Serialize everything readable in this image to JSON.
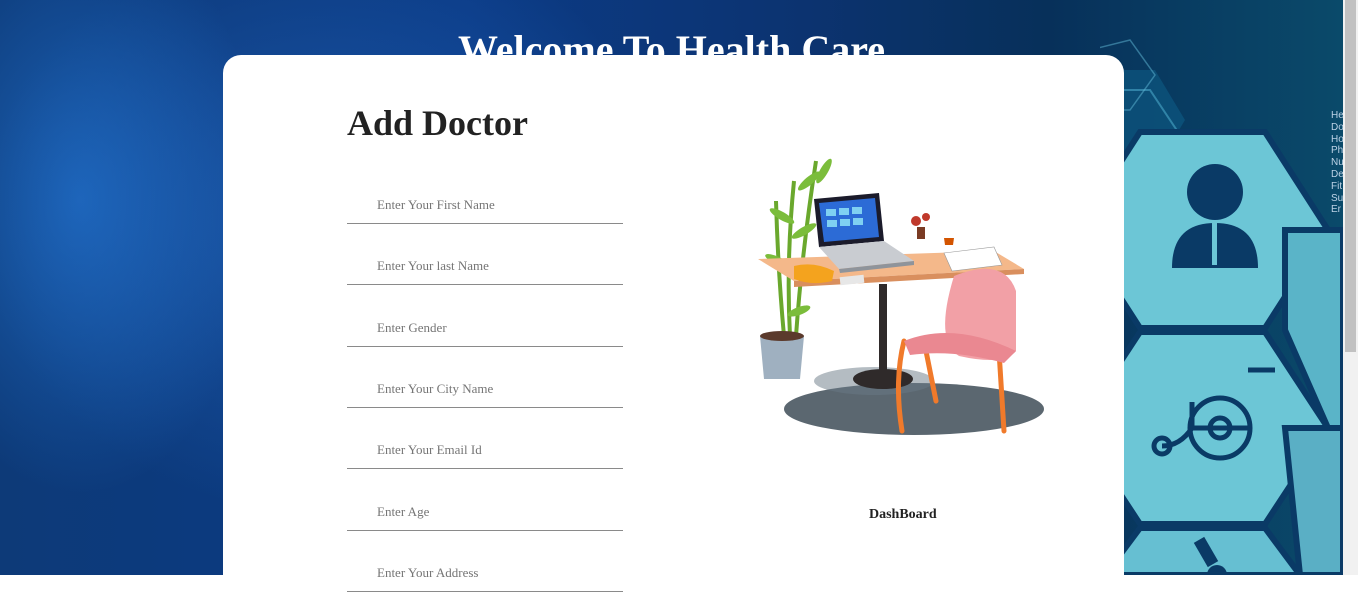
{
  "page": {
    "title": "Welcome To Health Care"
  },
  "form": {
    "heading": "Add Doctor",
    "fields": [
      {
        "placeholder": "Enter Your First Name"
      },
      {
        "placeholder": "Enter Your last Name"
      },
      {
        "placeholder": "Enter Gender"
      },
      {
        "placeholder": "Enter Your City Name"
      },
      {
        "placeholder": "Enter Your Email Id"
      },
      {
        "placeholder": "Enter Age"
      },
      {
        "placeholder": "Enter Your Address"
      }
    ]
  },
  "illustration": {
    "caption": "DashBoard",
    "icon": "desk-laptop-illustration"
  },
  "background": {
    "side_text": [
      "He",
      "Do",
      "Ho",
      "Ph",
      "Nu",
      "De",
      "Fit",
      "Su",
      "Er"
    ],
    "icons": [
      "doctor-icon",
      "wheelchair-icon",
      "microscope-icon"
    ]
  },
  "colors": {
    "background_blue": "#0b3b86",
    "hex_teal": "#6cc6d6",
    "card": "#ffffff",
    "title": "#ffffff"
  }
}
